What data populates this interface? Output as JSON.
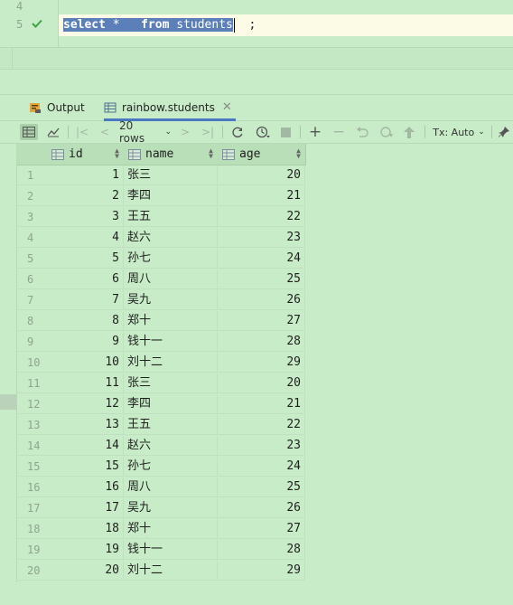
{
  "editor": {
    "line_numbers": [
      "4",
      "5"
    ],
    "sql": {
      "kw_select": "select",
      "star": "*",
      "kw_from": "from",
      "table": "students",
      "semicolon": ";"
    }
  },
  "tabs": [
    {
      "label": "Output",
      "icon": "output-icon"
    },
    {
      "label": "rainbow.students",
      "icon": "table-icon",
      "active": true
    }
  ],
  "toolbar": {
    "rows_label": "20 rows",
    "tx_label": "Tx: Auto",
    "icons": [
      "table-view-icon",
      "chart-view-icon",
      "first-page-icon",
      "prev-page-icon",
      "next-page-icon",
      "last-page-icon",
      "refresh-icon",
      "history-icon",
      "stop-icon",
      "add-row-icon",
      "delete-row-icon",
      "revert-icon",
      "submit-icon",
      "push-icon",
      "pin-icon"
    ]
  },
  "grid": {
    "columns": [
      "id",
      "name",
      "age"
    ],
    "rows": [
      {
        "rn": "1",
        "id": "1",
        "name": "张三",
        "age": "20"
      },
      {
        "rn": "2",
        "id": "2",
        "name": "李四",
        "age": "21"
      },
      {
        "rn": "3",
        "id": "3",
        "name": "王五",
        "age": "22"
      },
      {
        "rn": "4",
        "id": "4",
        "name": "赵六",
        "age": "23"
      },
      {
        "rn": "5",
        "id": "5",
        "name": "孙七",
        "age": "24"
      },
      {
        "rn": "6",
        "id": "6",
        "name": "周八",
        "age": "25"
      },
      {
        "rn": "7",
        "id": "7",
        "name": "吴九",
        "age": "26"
      },
      {
        "rn": "8",
        "id": "8",
        "name": "郑十",
        "age": "27"
      },
      {
        "rn": "9",
        "id": "9",
        "name": "钱十一",
        "age": "28"
      },
      {
        "rn": "10",
        "id": "10",
        "name": "刘十二",
        "age": "29"
      },
      {
        "rn": "11",
        "id": "11",
        "name": "张三",
        "age": "20"
      },
      {
        "rn": "12",
        "id": "12",
        "name": "李四",
        "age": "21"
      },
      {
        "rn": "13",
        "id": "13",
        "name": "王五",
        "age": "22"
      },
      {
        "rn": "14",
        "id": "14",
        "name": "赵六",
        "age": "23"
      },
      {
        "rn": "15",
        "id": "15",
        "name": "孙七",
        "age": "24"
      },
      {
        "rn": "16",
        "id": "16",
        "name": "周八",
        "age": "25"
      },
      {
        "rn": "17",
        "id": "17",
        "name": "吴九",
        "age": "26"
      },
      {
        "rn": "18",
        "id": "18",
        "name": "郑十",
        "age": "27"
      },
      {
        "rn": "19",
        "id": "19",
        "name": "钱十一",
        "age": "28"
      },
      {
        "rn": "20",
        "id": "20",
        "name": "刘十二",
        "age": "29"
      }
    ]
  },
  "colors": {
    "background": "#c8ecc8",
    "selection": "#5b7fb8",
    "current_line": "#fbfbe6",
    "active_tab_underline": "#4a78c2",
    "check": "#3fa04a"
  }
}
